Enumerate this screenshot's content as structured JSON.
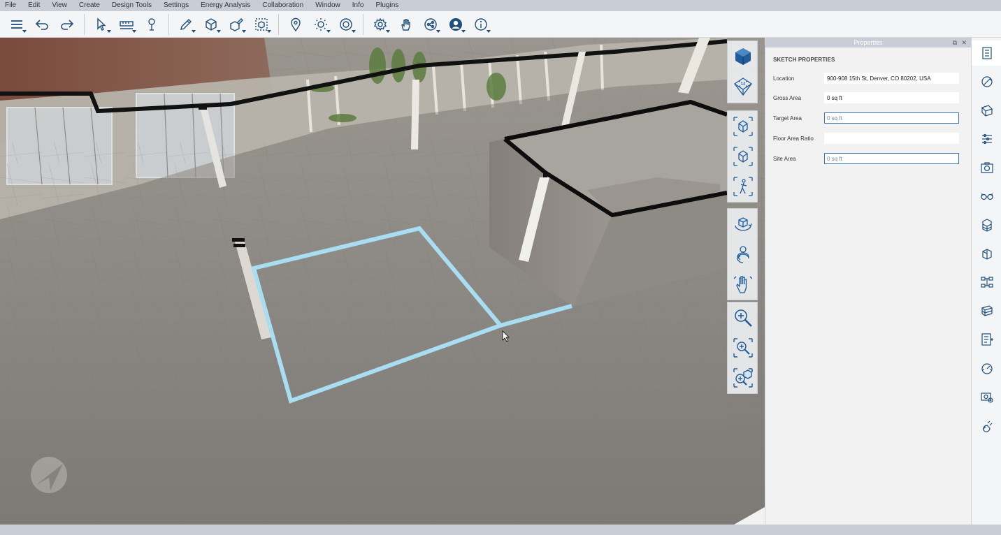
{
  "menu": [
    "File",
    "Edit",
    "View",
    "Create",
    "Design Tools",
    "Settings",
    "Energy Analysis",
    "Collaboration",
    "Window",
    "Info",
    "Plugins"
  ],
  "toolbar": {
    "groups": [
      [
        "layers-icon",
        "undo-icon",
        "redo-icon"
      ],
      [
        "select-icon",
        "measure-icon",
        "paint-icon"
      ],
      [
        "draw-icon",
        "add-mass-icon",
        "edit-mass-icon",
        "group-icon"
      ],
      [
        "location-icon",
        "sun-icon",
        "time-icon"
      ],
      [
        "settings-icon",
        "gesture-icon",
        "share-icon",
        "user-icon",
        "info-icon"
      ]
    ]
  },
  "nav_tools": [
    [
      "view-cube-icon",
      "perspective-icon"
    ],
    [
      "walk-forward-icon",
      "camera-view-icon",
      "person-walk-icon"
    ],
    [
      "orbit-icon",
      "turn-icon",
      "pan-hand-icon"
    ],
    [
      "zoom-icon",
      "zoom-window-icon",
      "zoom-extents-icon"
    ]
  ],
  "properties": {
    "title": "Properties",
    "heading": "SKETCH PROPERTIES",
    "rows": [
      {
        "label": "Location",
        "value": "900-908 15th St, Denver, CO 80202, USA",
        "editable": false
      },
      {
        "label": "Gross Area",
        "value": "0 sq ft",
        "editable": false
      },
      {
        "label": "Target Area",
        "value": "0 sq ft",
        "editable": true
      },
      {
        "label": "Floor Area Ratio",
        "value": "",
        "editable": false
      },
      {
        "label": "Site Area",
        "value": "0 sq ft",
        "editable": true
      }
    ]
  },
  "right_strip": [
    "properties-panel-icon",
    "sketch-icon",
    "materials-icon",
    "layers-panel-icon",
    "camera-icon",
    "glasses-icon",
    "building-icon",
    "section-icon",
    "hierarchy-icon",
    "stacking-icon",
    "report-icon",
    "dashboard-icon",
    "screenshot-icon",
    "plugin-icon"
  ],
  "colors": {
    "accent": "#1f4f7c",
    "sketch_outline": "#a9ddf2",
    "chrome": "#c9ced6",
    "field_border": "#3b76b0"
  }
}
